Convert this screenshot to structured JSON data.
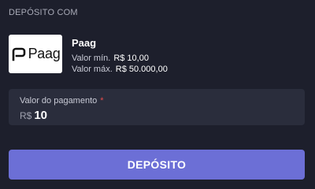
{
  "section_title": "DEPÓSITO COM",
  "method": {
    "logo_icon": "paag-logo-icon",
    "logo_text": "Paag",
    "name": "Paag",
    "min_label": "Valor mín.",
    "min_value": "R$ 10,00",
    "max_label": "Valor máx.",
    "max_value": "R$ 50.000,00"
  },
  "amount": {
    "label": "Valor do pagamento",
    "required_mark": "*",
    "currency": "R$",
    "value": "10"
  },
  "deposit_button": {
    "label": "DEPÓSITO"
  },
  "colors": {
    "background": "#1d1f2c",
    "field": "#2a2d3c",
    "accent": "#6c6fd6",
    "required": "#e64b4b"
  }
}
